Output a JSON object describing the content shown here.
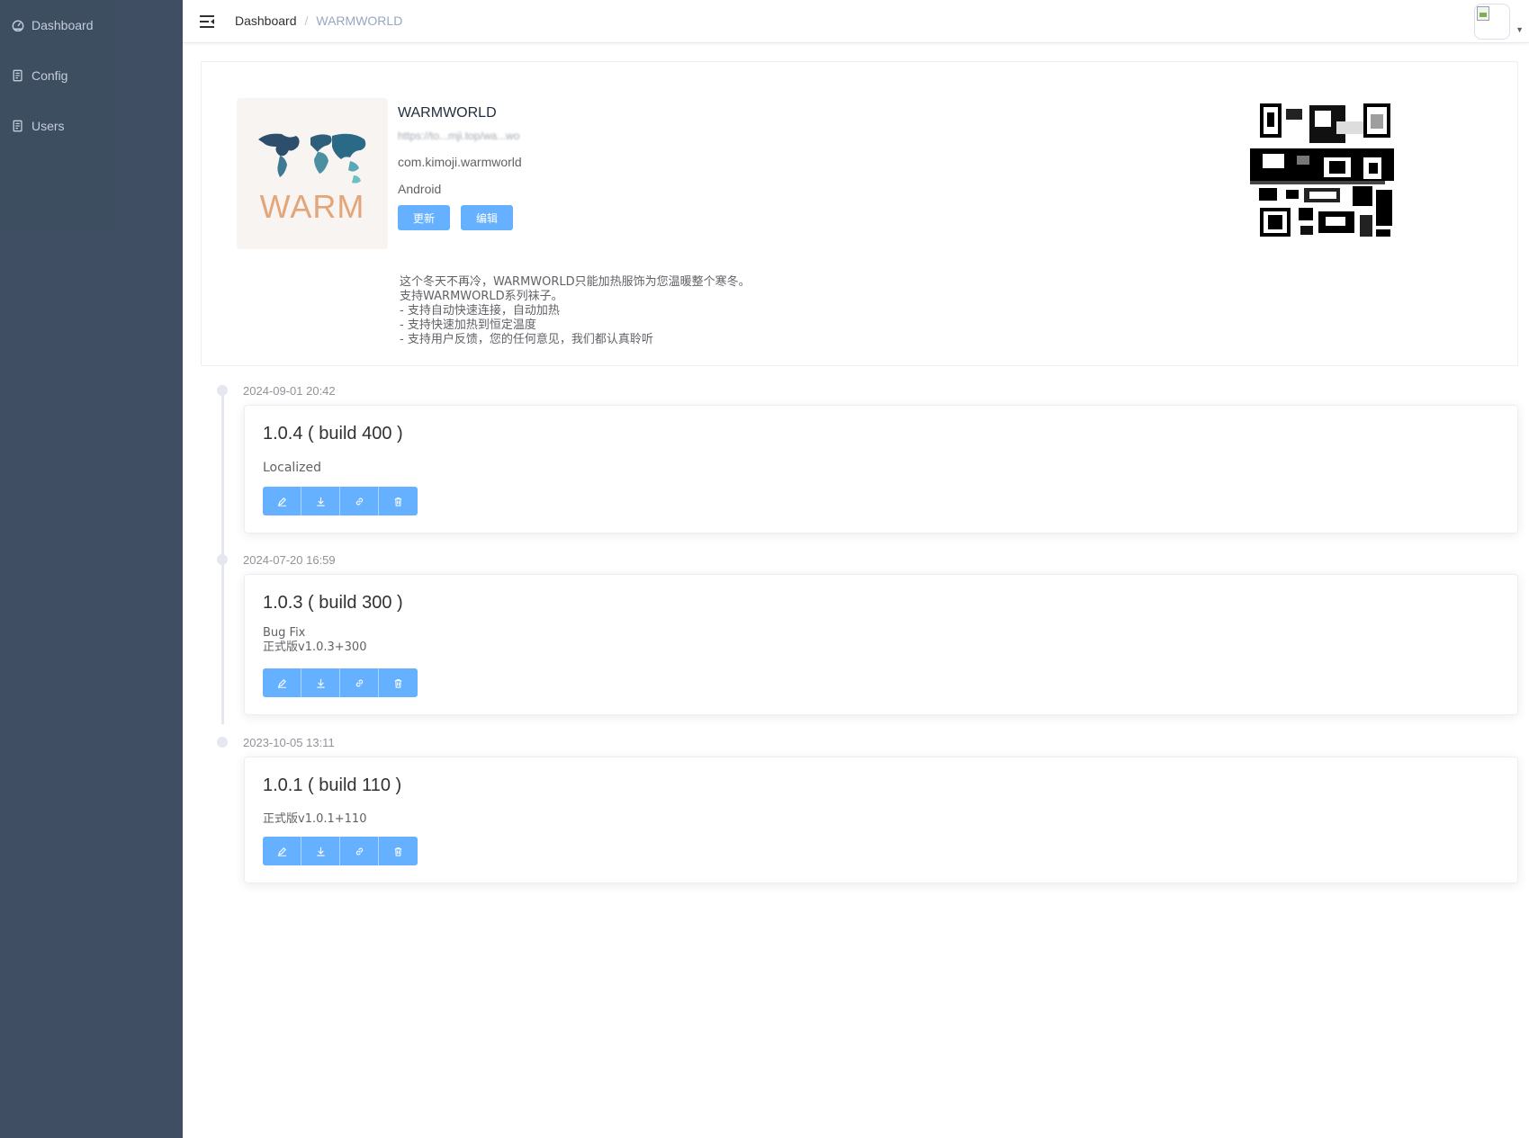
{
  "sidebar": {
    "items": [
      {
        "label": "Dashboard",
        "icon": "dashboard-icon"
      },
      {
        "label": "Config",
        "icon": "document-icon"
      },
      {
        "label": "Users",
        "icon": "document-icon"
      }
    ]
  },
  "navbar": {
    "breadcrumb": {
      "root": "Dashboard",
      "separator": "/",
      "current": "WARMWORLD"
    }
  },
  "app": {
    "icon_text": "WARM",
    "name": "WARMWORLD",
    "url": "https://to...mji.top/wa...wo",
    "bundle_id": "com.kimoji.warmworld",
    "platform": "Android",
    "update_label": "更新",
    "edit_label": "编辑",
    "description": "这个冬天不再冷，WARMWORLD只能加热服饰为您温暖整个寒冬。\n支持WARMWORLD系列袜子。\n- 支持自动快速连接，自动加热\n- 支持快速加热到恒定温度\n- 支持用户反馈，您的任何意见，我们都认真聆听"
  },
  "colors": {
    "sidebar_bg": "#304156",
    "primary_button": "#66b1ff",
    "timeline": "#e4e7ed"
  },
  "releases": [
    {
      "time": "2024-09-01 20:42",
      "title": "1.0.4 ( build 400 )",
      "note": "Localized"
    },
    {
      "time": "2024-07-20 16:59",
      "title": "1.0.3 ( build 300 )",
      "note": "Bug Fix\n正式版v1.0.3+300"
    },
    {
      "time": "2023-10-05 13:11",
      "title": "1.0.1 ( build 110 )",
      "note": "正式版v1.0.1+110"
    }
  ],
  "release_actions": [
    "edit-icon",
    "download-icon",
    "link-icon",
    "delete-icon"
  ]
}
